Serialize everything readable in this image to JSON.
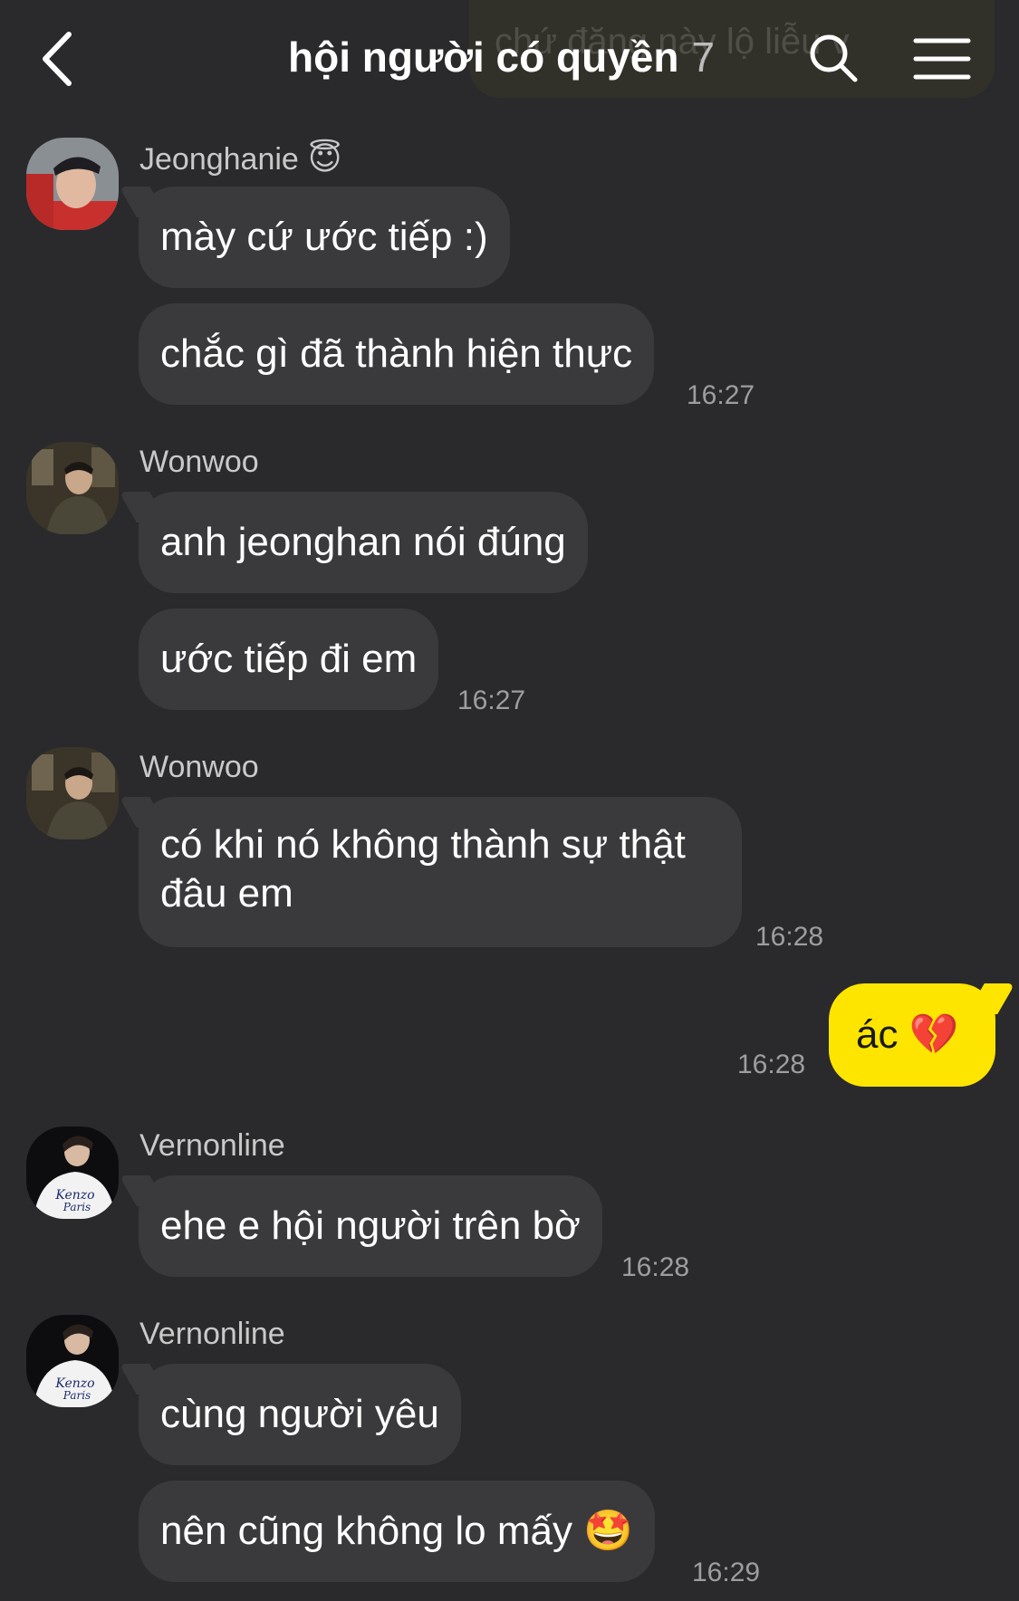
{
  "header": {
    "title": "hội người có quyền",
    "member_count": "7",
    "ghost_preview": "chứ đăng này lộ liễu v"
  },
  "messages": [
    {
      "sender": "Jeonghanie",
      "sender_emoji": "😇",
      "bubbles": [
        "mày cứ ước tiếp :)",
        "chắc gì đã thành hiện thực"
      ],
      "time": "16:27"
    },
    {
      "sender": "Wonwoo",
      "bubbles": [
        "anh jeonghan nói đúng",
        "ước tiếp đi em"
      ],
      "time": "16:27"
    },
    {
      "sender": "Wonwoo",
      "bubbles": [
        "có khi nó không thành sự thật đâu em"
      ],
      "time": "16:28"
    },
    {
      "sender": "me",
      "bubbles": [
        "ác",
        "💔"
      ],
      "time": "16:28"
    },
    {
      "sender": "Vernonline",
      "bubbles": [
        "ehe e hội người trên bờ"
      ],
      "time": "16:28"
    },
    {
      "sender": "Vernonline",
      "bubbles": [
        "cùng người yêu",
        "nên cũng không lo mấy",
        "🤩"
      ],
      "time": "16:29"
    }
  ],
  "avatar_shirt_text": [
    "Kenzo",
    "Paris"
  ],
  "colors": {
    "background": "#2a2a2d",
    "bubble_other": "#3a3a3d",
    "bubble_me": "#fee500"
  }
}
